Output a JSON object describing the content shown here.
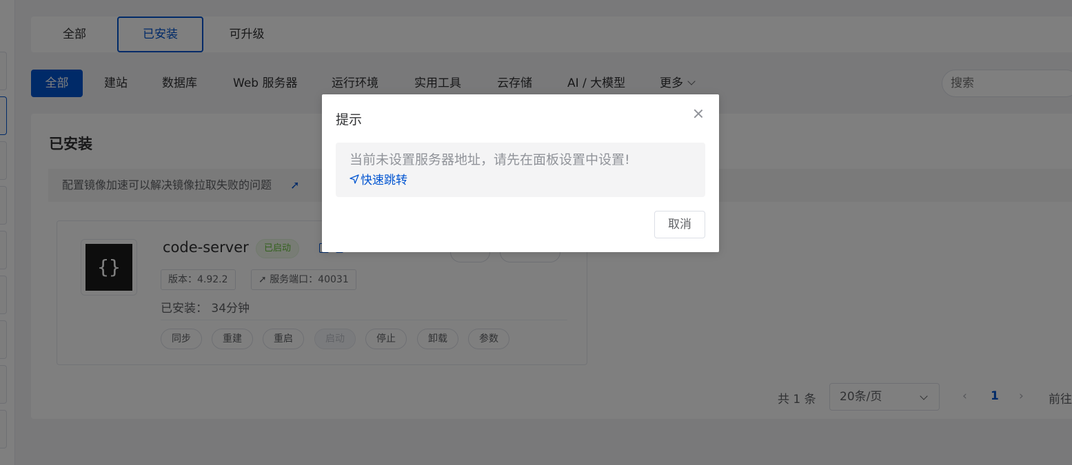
{
  "top_tabs": [
    {
      "label": "全部"
    },
    {
      "label": "已安装",
      "active": true
    },
    {
      "label": "可升级"
    }
  ],
  "categories": [
    {
      "label": "全部",
      "active": true
    },
    {
      "label": "建站"
    },
    {
      "label": "数据库"
    },
    {
      "label": "Web 服务器"
    },
    {
      "label": "运行环境"
    },
    {
      "label": "实用工具"
    },
    {
      "label": "云存储"
    },
    {
      "label": "AI / 大模型"
    },
    {
      "label": "更多"
    }
  ],
  "search": {
    "placeholder": "搜索"
  },
  "section": {
    "title": "已安装",
    "notice": "配置镜像加速可以解决镜像拉取失败的问题"
  },
  "app": {
    "logo_text": "{}",
    "name": "code-server",
    "status": "已启动",
    "version_tag": "版本：4.92.2",
    "port_tag": "服务端口：40031",
    "installed_time": "已安装： 34分钟",
    "actions": [
      "同步",
      "重建",
      "重启",
      "启动",
      "停止",
      "卸载",
      "参数"
    ]
  },
  "pagination": {
    "total": "共 1 条",
    "page_size": "20条/页",
    "current": "1",
    "goto": "前往"
  },
  "dialog": {
    "title": "提示",
    "message": "当前未设置服务器地址，请先在面板设置中设置!",
    "link": "快速跳转",
    "cancel": "取消"
  },
  "colors": {
    "primary": "#0054d1",
    "success": "#67c23a",
    "overlay": "rgba(0,0,0,0.5)"
  }
}
